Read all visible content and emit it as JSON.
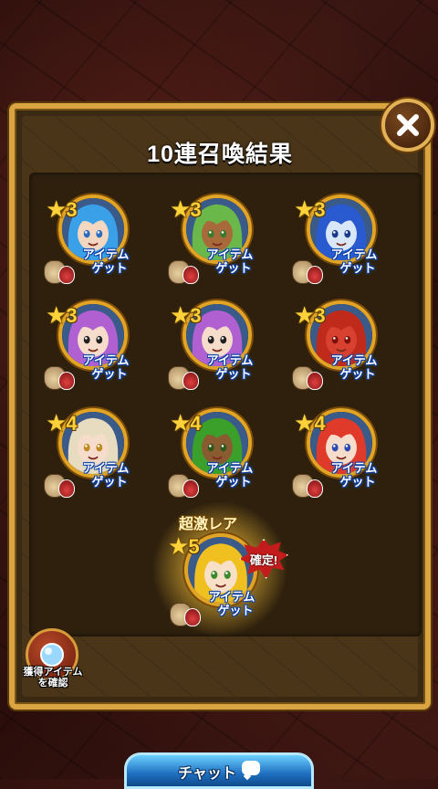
{
  "title": "10連召喚結果",
  "close_button": {
    "icon": "close-icon"
  },
  "results": [
    {
      "stars": "3",
      "item_line1": "アイテム",
      "item_line2": "ゲット",
      "hair": "#3aa0e8",
      "skin": "#f4d7c0",
      "accent": "#2b6cc0"
    },
    {
      "stars": "3",
      "item_line1": "アイテム",
      "item_line2": "ゲット",
      "hair": "#6ab84a",
      "skin": "#a86a3a",
      "accent": "#3a7a2a"
    },
    {
      "stars": "3",
      "item_line1": "アイテム",
      "item_line2": "ゲット",
      "hair": "#2a5ad0",
      "skin": "#d8e8f8",
      "accent": "#1a3a8a"
    },
    {
      "stars": "3",
      "item_line1": "アイテム",
      "item_line2": "ゲット",
      "hair": "#b060d0",
      "skin": "#f6dccb",
      "accent": "#202020"
    },
    {
      "stars": "3",
      "item_line1": "アイテム",
      "item_line2": "ゲット",
      "hair": "#b060d0",
      "skin": "#f6dccb",
      "accent": "#202020"
    },
    {
      "stars": "3",
      "item_line1": "アイテム",
      "item_line2": "ゲット",
      "hair": "#c02a1a",
      "skin": "#d84030",
      "accent": "#7a1008"
    },
    {
      "stars": "4",
      "item_line1": "アイテム",
      "item_line2": "ゲット",
      "hair": "#e8dcc0",
      "skin": "#f6dccb",
      "accent": "#c08a20"
    },
    {
      "stars": "4",
      "item_line1": "アイテム",
      "item_line2": "ゲット",
      "hair": "#3aa02a",
      "skin": "#8a5a30",
      "accent": "#2a5a1a"
    },
    {
      "stars": "4",
      "item_line1": "アイテム",
      "item_line2": "ゲット",
      "hair": "#e03a2a",
      "skin": "#f6dccb",
      "accent": "#2a4ab0"
    }
  ],
  "featured": {
    "rarity_label": "超激レア",
    "stars": "5",
    "confirm_label": "確定!",
    "item_line1": "アイテム",
    "item_line2": "ゲット",
    "hair": "#f0c020",
    "skin": "#f8e0c8",
    "accent": "#3a8a2a"
  },
  "acquired_items_button": {
    "line1": "獲得アイテム",
    "line2": "を確認"
  },
  "chat_button": {
    "label": "チャット",
    "icon": "chat-bubble-icon"
  }
}
